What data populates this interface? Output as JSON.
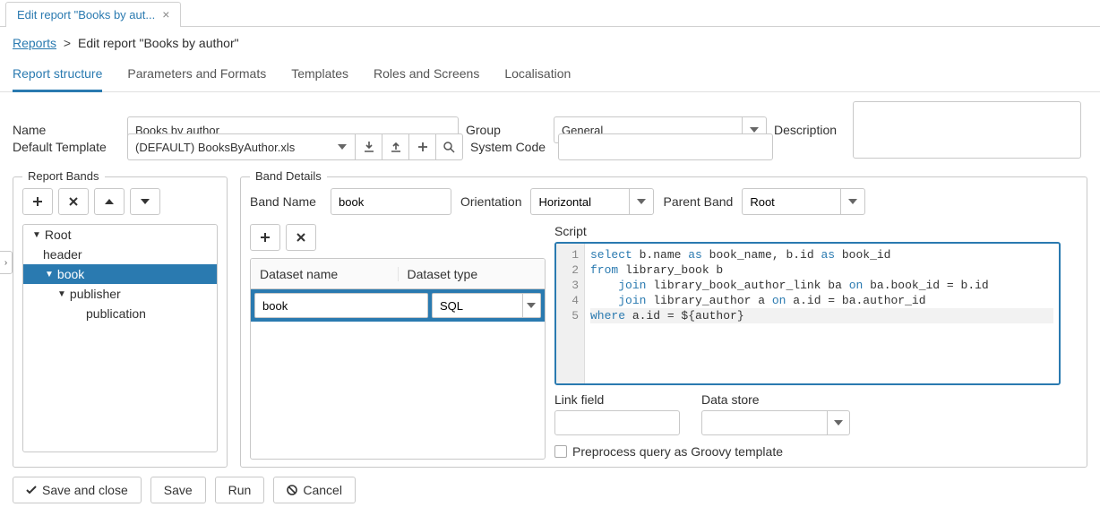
{
  "topTab": {
    "title": "Edit report \"Books by aut...",
    "closeIcon": "×"
  },
  "breadcrumb": {
    "root": "Reports",
    "current": "Edit report \"Books by author\""
  },
  "secTabs": [
    "Report structure",
    "Parameters and Formats",
    "Templates",
    "Roles and Screens",
    "Localisation"
  ],
  "form": {
    "nameLabel": "Name",
    "nameValue": "Books by author",
    "groupLabel": "Group",
    "groupValue": "General",
    "descLabel": "Description",
    "tmplLabel": "Default Template",
    "tmplValue": "(DEFAULT) BooksByAuthor.xls",
    "syscodeLabel": "System Code",
    "syscodeValue": ""
  },
  "bandsPanel": {
    "legend": "Report Bands",
    "tree": {
      "root": "Root",
      "items": [
        "header",
        "book",
        "publisher",
        "publication"
      ],
      "selectedIndex": 1
    }
  },
  "detailsPanel": {
    "legend": "Band Details",
    "bandNameLabel": "Band Name",
    "bandNameValue": "book",
    "orientationLabel": "Orientation",
    "orientationValue": "Horizontal",
    "parentLabel": "Parent Band",
    "parentValue": "Root",
    "dsHeaders": [
      "Dataset name",
      "Dataset type"
    ],
    "dsRow": {
      "name": "book",
      "type": "SQL"
    },
    "scriptLabel": "Script",
    "scriptLines": [
      [
        {
          "t": "select",
          "kw": true
        },
        {
          "t": " b.name "
        },
        {
          "t": "as",
          "kw": true
        },
        {
          "t": " book_name, b.id "
        },
        {
          "t": "as",
          "kw": true
        },
        {
          "t": " book_id"
        }
      ],
      [
        {
          "t": "from",
          "kw": true
        },
        {
          "t": " library_book b"
        }
      ],
      [
        {
          "t": "    "
        },
        {
          "t": "join",
          "kw": true
        },
        {
          "t": " library_book_author_link ba "
        },
        {
          "t": "on",
          "kw": true
        },
        {
          "t": " ba.book_id = b.id"
        }
      ],
      [
        {
          "t": "    "
        },
        {
          "t": "join",
          "kw": true
        },
        {
          "t": " library_author a "
        },
        {
          "t": "on",
          "kw": true
        },
        {
          "t": " a.id = ba.author_id"
        }
      ],
      [
        {
          "t": "where",
          "kw": true
        },
        {
          "t": " a.id = ${author}"
        }
      ]
    ],
    "linkFieldLabel": "Link field",
    "dataStoreLabel": "Data store",
    "preprocLabel": "Preprocess query as Groovy template"
  },
  "footer": {
    "saveClose": "Save and close",
    "save": "Save",
    "run": "Run",
    "cancel": "Cancel"
  }
}
